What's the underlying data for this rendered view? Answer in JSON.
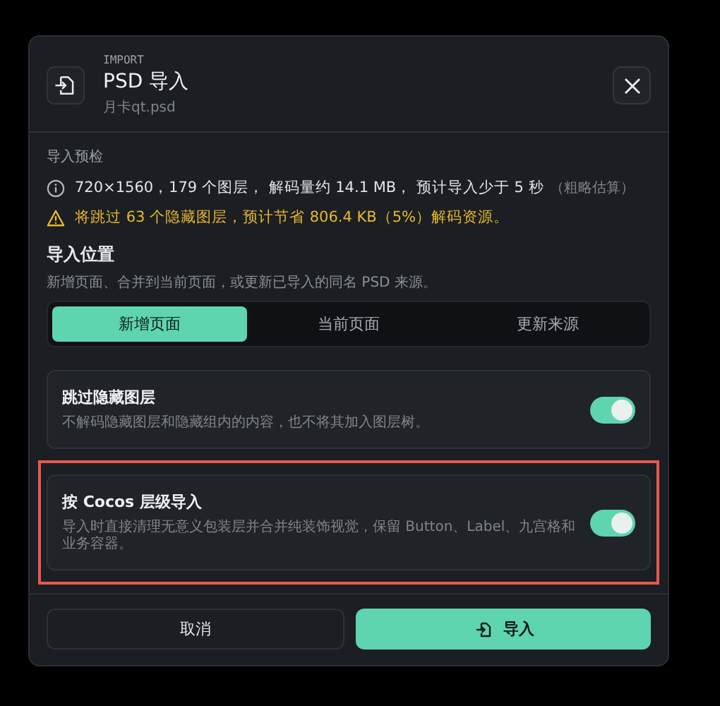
{
  "dialog": {
    "eyebrow": "IMPORT",
    "title": "PSD 导入",
    "filename": "月卡qt.psd"
  },
  "preview": {
    "heading": "导入预检",
    "info": "720×1560，179 个图层， 解码量约 14.1 MB， 预计导入少于 5 秒",
    "info_note": "（粗略估算）",
    "warning": "将跳过 63 个隐藏图层，预计节省 806.4 KB（5%）解码资源。"
  },
  "location": {
    "heading": "导入位置",
    "description": "新增页面、合并到当前页面，或更新已导入的同名 PSD 来源。",
    "tabs": [
      {
        "label": "新增页面",
        "selected": true
      },
      {
        "label": "当前页面",
        "selected": false
      },
      {
        "label": "更新来源",
        "selected": false
      }
    ]
  },
  "options": [
    {
      "title": "跳过隐藏图层",
      "description": "不解码隐藏图层和隐藏组内的内容，也不将其加入图层树。",
      "on": true,
      "highlighted": false
    },
    {
      "title": "按 Cocos 层级导入",
      "description": "导入时直接清理无意义包装层并合并纯装饰视觉，保留 Button、Label、九宫格和业务容器。",
      "on": true,
      "highlighted": true
    }
  ],
  "buttons": {
    "cancel": "取消",
    "import": "导入"
  }
}
